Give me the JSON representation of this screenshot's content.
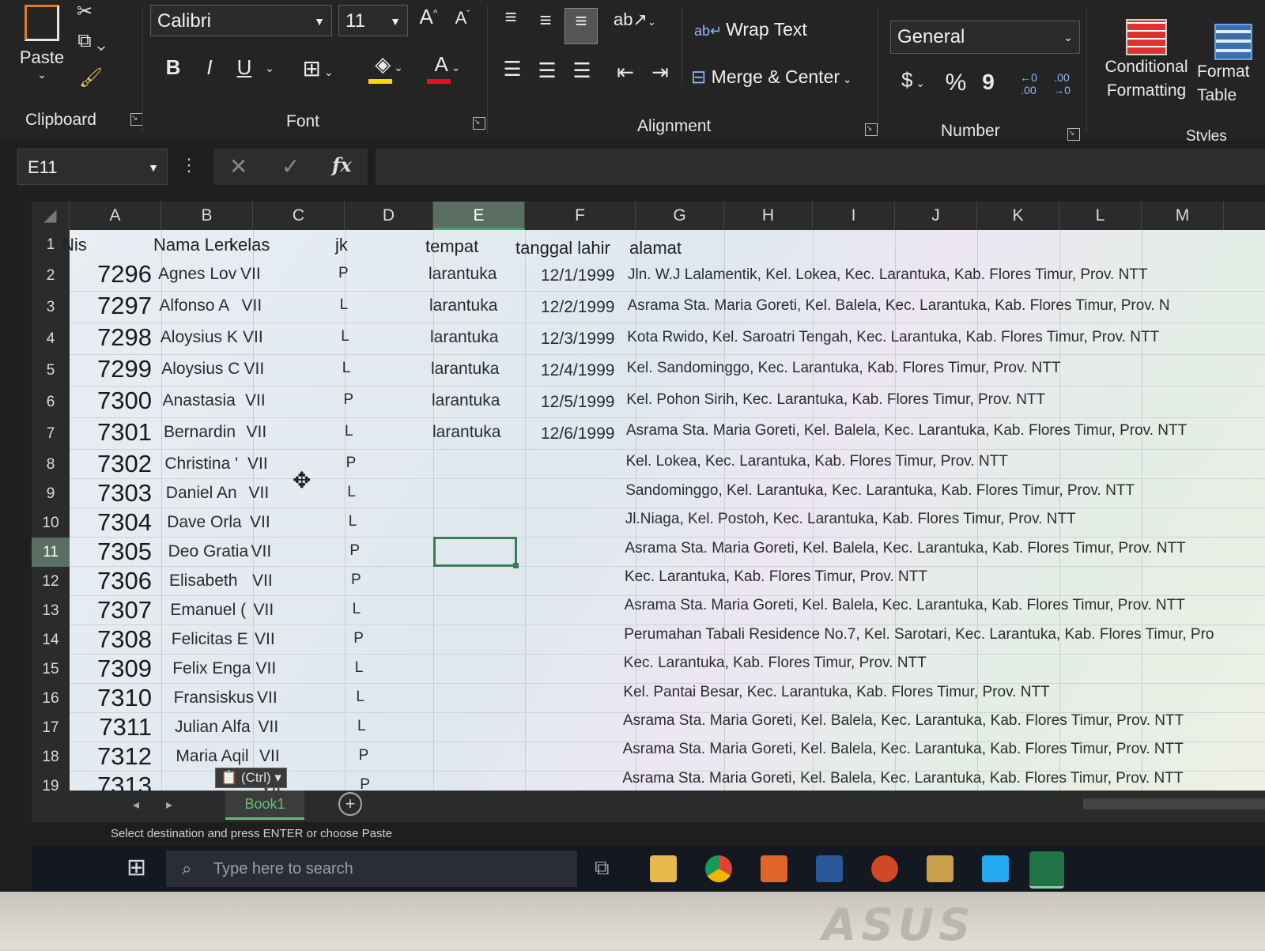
{
  "ribbon": {
    "clipboard": {
      "paste_label": "Paste",
      "group_label": "Clipboard"
    },
    "font": {
      "group_label": "Font",
      "font_name": "Calibri",
      "font_size": "11",
      "grow_label": "A",
      "shrink_label": "A",
      "bold_label": "B",
      "italic_label": "I",
      "underline_label": "U",
      "font_color_label": "A",
      "fill_color": "#ffd700",
      "font_color": "#e81123"
    },
    "alignment": {
      "group_label": "Alignment",
      "wrap_text_label": "Wrap Text",
      "merge_center_label": "Merge & Center"
    },
    "number": {
      "group_label": "Number",
      "format_value": "General",
      "currency_label": "$",
      "percent_label": "%",
      "comma_label": "9"
    },
    "styles": {
      "group_label": "Styles",
      "conditional_formatting_label": "Conditional Formatting",
      "format_table_label": "Format Table"
    }
  },
  "formula_bar": {
    "name_box": "E11",
    "fx_label": "fx",
    "value": ""
  },
  "sheet": {
    "columns": [
      "A",
      "B",
      "C",
      "D",
      "E",
      "F",
      "G",
      "H",
      "I",
      "J",
      "K",
      "L",
      "M"
    ],
    "selected_column": "E",
    "selected_row": "11",
    "header_row": {
      "row": "1",
      "a": "Nis",
      "b": "Nama Len",
      "c": "kelas",
      "d": "jk",
      "e": "tempat",
      "f": "tanggal lahir",
      "g": "alamat"
    },
    "rows": [
      {
        "row": "2",
        "nis": "7296",
        "nama": "Agnes Lov",
        "kelas": "VII",
        "jk": "P",
        "tempat": "larantuka",
        "tgl": "12/1/1999",
        "alamat": "Jln. W.J Lalamentik, Kel. Lokea, Kec. Larantuka, Kab. Flores Timur, Prov. NTT"
      },
      {
        "row": "3",
        "nis": "7297",
        "nama": "Alfonso A",
        "kelas": "VII",
        "jk": "L",
        "tempat": "larantuka",
        "tgl": "12/2/1999",
        "alamat": "Asrama Sta. Maria Goreti, Kel. Balela, Kec. Larantuka, Kab. Flores Timur, Prov. N"
      },
      {
        "row": "4",
        "nis": "7298",
        "nama": "Aloysius K",
        "kelas": "VII",
        "jk": "L",
        "tempat": "larantuka",
        "tgl": "12/3/1999",
        "alamat": "Kota Rwido, Kel. Saroatri Tengah, Kec. Larantuka, Kab. Flores Timur, Prov. NTT"
      },
      {
        "row": "5",
        "nis": "7299",
        "nama": "Aloysius C",
        "kelas": "VII",
        "jk": "L",
        "tempat": "larantuka",
        "tgl": "12/4/1999",
        "alamat": "Kel. Sandominggo, Kec. Larantuka, Kab. Flores Timur, Prov. NTT"
      },
      {
        "row": "6",
        "nis": "7300",
        "nama": "Anastasia",
        "kelas": "VII",
        "jk": "P",
        "tempat": "larantuka",
        "tgl": "12/5/1999",
        "alamat": "Kel. Pohon Sirih, Kec. Larantuka, Kab. Flores Timur, Prov. NTT"
      },
      {
        "row": "7",
        "nis": "7301",
        "nama": "Bernardin",
        "kelas": "VII",
        "jk": "L",
        "tempat": "larantuka",
        "tgl": "12/6/1999",
        "alamat": "Asrama Sta. Maria Goreti, Kel. Balela, Kec. Larantuka, Kab. Flores Timur, Prov. NTT"
      },
      {
        "row": "8",
        "nis": "7302",
        "nama": "Christina '",
        "kelas": "VII",
        "jk": "P",
        "tempat": "",
        "tgl": "",
        "alamat": "Kel. Lokea, Kec. Larantuka, Kab. Flores Timur, Prov. NTT"
      },
      {
        "row": "9",
        "nis": "7303",
        "nama": "Daniel An",
        "kelas": "VII",
        "jk": "L",
        "tempat": "",
        "tgl": "",
        "alamat": "Sandominggo, Kel. Larantuka, Kec. Larantuka, Kab. Flores Timur, Prov. NTT"
      },
      {
        "row": "10",
        "nis": "7304",
        "nama": "Dave Orla",
        "kelas": "VII",
        "jk": "L",
        "tempat": "",
        "tgl": "",
        "alamat": "Jl.Niaga, Kel. Postoh, Kec. Larantuka, Kab. Flores Timur, Prov. NTT"
      },
      {
        "row": "11",
        "nis": "7305",
        "nama": "Deo Gratia",
        "kelas": "VII",
        "jk": "P",
        "tempat": "",
        "tgl": "",
        "alamat": "Asrama Sta. Maria Goreti, Kel. Balela, Kec. Larantuka, Kab. Flores Timur, Prov. NTT"
      },
      {
        "row": "12",
        "nis": "7306",
        "nama": "Elisabeth",
        "kelas": "VII",
        "jk": "P",
        "tempat": "",
        "tgl": "",
        "alamat": "Kec. Larantuka, Kab. Flores Timur, Prov. NTT"
      },
      {
        "row": "13",
        "nis": "7307",
        "nama": "Emanuel (",
        "kelas": "VII",
        "jk": "L",
        "tempat": "",
        "tgl": "",
        "alamat": "Asrama Sta. Maria Goreti, Kel. Balela, Kec. Larantuka, Kab. Flores Timur, Prov. NTT"
      },
      {
        "row": "14",
        "nis": "7308",
        "nama": "Felicitas E",
        "kelas": "VII",
        "jk": "P",
        "tempat": "",
        "tgl": "",
        "alamat": "Perumahan Tabali Residence No.7, Kel. Sarotari, Kec. Larantuka, Kab. Flores Timur, Pro"
      },
      {
        "row": "15",
        "nis": "7309",
        "nama": "Felix Enga",
        "kelas": "VII",
        "jk": "L",
        "tempat": "",
        "tgl": "",
        "alamat": "Kec. Larantuka, Kab. Flores Timur, Prov. NTT"
      },
      {
        "row": "16",
        "nis": "7310",
        "nama": "Fransiskus",
        "kelas": "VII",
        "jk": "L",
        "tempat": "",
        "tgl": "",
        "alamat": "Kel. Pantai Besar, Kec. Larantuka, Kab. Flores Timur, Prov. NTT"
      },
      {
        "row": "17",
        "nis": "7311",
        "nama": "Julian Alfa",
        "kelas": "VII",
        "jk": "L",
        "tempat": "",
        "tgl": "",
        "alamat": "Asrama Sta. Maria Goreti, Kel. Balela, Kec. Larantuka, Kab. Flores Timur, Prov. NTT"
      },
      {
        "row": "18",
        "nis": "7312",
        "nama": "Maria Aqil",
        "kelas": "VII",
        "jk": "P",
        "tempat": "",
        "tgl": "",
        "alamat": "Asrama Sta. Maria Goreti, Kel. Balela, Kec. Larantuka, Kab. Flores Timur, Prov. NTT"
      },
      {
        "row": "19",
        "nis": "7313",
        "nama": "",
        "kelas": "VII",
        "jk": "P",
        "tempat": "",
        "tgl": "",
        "alamat": "Asrama Sta. Maria Goreti, Kel. Balela, Kec. Larantuka, Kab. Flores Timur, Prov. NTT"
      }
    ],
    "paste_options_label": "(Ctrl)",
    "sheet_tab": "Book1",
    "add_sheet_label": "+"
  },
  "status_bar": {
    "message": "Select destination and press ENTER or choose Paste"
  },
  "taskbar": {
    "search_placeholder": "Type here to search"
  },
  "monitor": {
    "brand": "ASUS"
  }
}
